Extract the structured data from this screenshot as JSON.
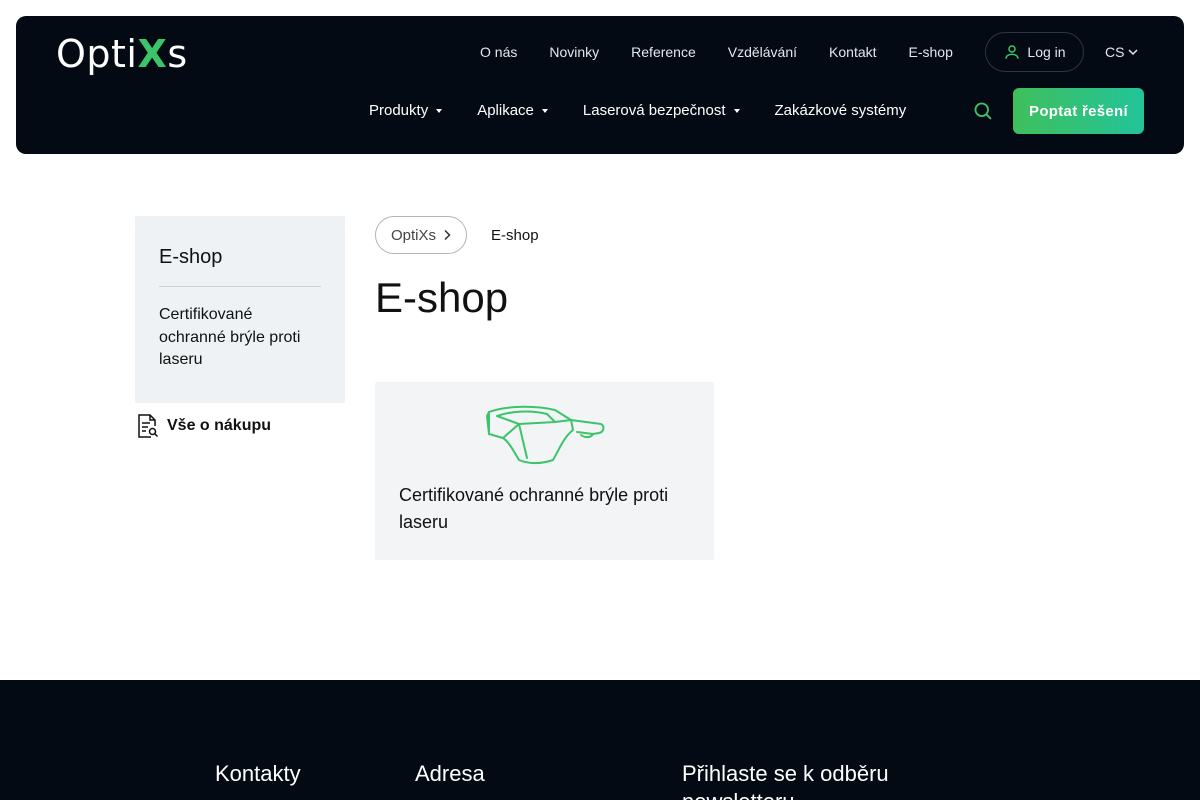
{
  "header": {
    "logo": {
      "prefix": "Opti",
      "accent": "X",
      "suffix": "s"
    },
    "top_nav": [
      "O nás",
      "Novinky",
      "Reference",
      "Vzdělávání",
      "Kontakt",
      "E-shop"
    ],
    "login_label": "Log in",
    "language": "CS",
    "main_nav": [
      {
        "label": "Produkty"
      },
      {
        "label": "Aplikace"
      },
      {
        "label": "Laserová bezpečnost"
      },
      {
        "label": "Zakázkové systémy"
      }
    ],
    "cta_label": "Poptat řešení"
  },
  "sidebar": {
    "title": "E-shop",
    "items": [
      "Certifikované ochranné brýle proti laseru"
    ],
    "purchase_link": "Vše o nákupu"
  },
  "breadcrumb": {
    "home": "OptiXs",
    "current": "E-shop"
  },
  "page_title": "E-shop",
  "card": {
    "label": "Certifikované ochranné brýle proti laseru"
  },
  "footer": {
    "columns": [
      "Kontakty",
      "Adresa",
      "Přihlaste se k odběru newsletteru"
    ]
  },
  "colors": {
    "header_bg": "#030a14",
    "accent_green": "#3cc46a",
    "cta_gradient_end": "#22c49a",
    "sidebar_bg": "#eff2f4"
  },
  "icons": [
    "user-icon",
    "chevron-down-icon",
    "search-icon",
    "document-search-icon",
    "chevron-right-icon",
    "safety-glasses-icon"
  ]
}
